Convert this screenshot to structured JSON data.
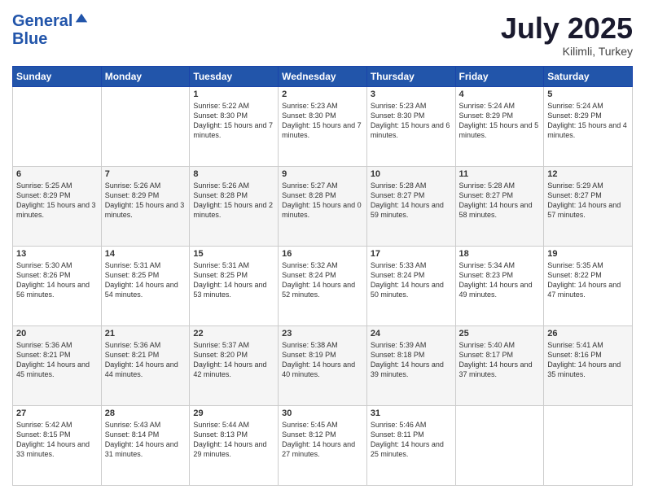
{
  "logo": {
    "line1": "General",
    "line2": "Blue"
  },
  "title": "July 2025",
  "location": "Kilimli, Turkey",
  "weekdays": [
    "Sunday",
    "Monday",
    "Tuesday",
    "Wednesday",
    "Thursday",
    "Friday",
    "Saturday"
  ],
  "weeks": [
    [
      {
        "day": "",
        "sunrise": "",
        "sunset": "",
        "daylight": ""
      },
      {
        "day": "",
        "sunrise": "",
        "sunset": "",
        "daylight": ""
      },
      {
        "day": "1",
        "sunrise": "Sunrise: 5:22 AM",
        "sunset": "Sunset: 8:30 PM",
        "daylight": "Daylight: 15 hours and 7 minutes."
      },
      {
        "day": "2",
        "sunrise": "Sunrise: 5:23 AM",
        "sunset": "Sunset: 8:30 PM",
        "daylight": "Daylight: 15 hours and 7 minutes."
      },
      {
        "day": "3",
        "sunrise": "Sunrise: 5:23 AM",
        "sunset": "Sunset: 8:30 PM",
        "daylight": "Daylight: 15 hours and 6 minutes."
      },
      {
        "day": "4",
        "sunrise": "Sunrise: 5:24 AM",
        "sunset": "Sunset: 8:29 PM",
        "daylight": "Daylight: 15 hours and 5 minutes."
      },
      {
        "day": "5",
        "sunrise": "Sunrise: 5:24 AM",
        "sunset": "Sunset: 8:29 PM",
        "daylight": "Daylight: 15 hours and 4 minutes."
      }
    ],
    [
      {
        "day": "6",
        "sunrise": "Sunrise: 5:25 AM",
        "sunset": "Sunset: 8:29 PM",
        "daylight": "Daylight: 15 hours and 3 minutes."
      },
      {
        "day": "7",
        "sunrise": "Sunrise: 5:26 AM",
        "sunset": "Sunset: 8:29 PM",
        "daylight": "Daylight: 15 hours and 3 minutes."
      },
      {
        "day": "8",
        "sunrise": "Sunrise: 5:26 AM",
        "sunset": "Sunset: 8:28 PM",
        "daylight": "Daylight: 15 hours and 2 minutes."
      },
      {
        "day": "9",
        "sunrise": "Sunrise: 5:27 AM",
        "sunset": "Sunset: 8:28 PM",
        "daylight": "Daylight: 15 hours and 0 minutes."
      },
      {
        "day": "10",
        "sunrise": "Sunrise: 5:28 AM",
        "sunset": "Sunset: 8:27 PM",
        "daylight": "Daylight: 14 hours and 59 minutes."
      },
      {
        "day": "11",
        "sunrise": "Sunrise: 5:28 AM",
        "sunset": "Sunset: 8:27 PM",
        "daylight": "Daylight: 14 hours and 58 minutes."
      },
      {
        "day": "12",
        "sunrise": "Sunrise: 5:29 AM",
        "sunset": "Sunset: 8:27 PM",
        "daylight": "Daylight: 14 hours and 57 minutes."
      }
    ],
    [
      {
        "day": "13",
        "sunrise": "Sunrise: 5:30 AM",
        "sunset": "Sunset: 8:26 PM",
        "daylight": "Daylight: 14 hours and 56 minutes."
      },
      {
        "day": "14",
        "sunrise": "Sunrise: 5:31 AM",
        "sunset": "Sunset: 8:25 PM",
        "daylight": "Daylight: 14 hours and 54 minutes."
      },
      {
        "day": "15",
        "sunrise": "Sunrise: 5:31 AM",
        "sunset": "Sunset: 8:25 PM",
        "daylight": "Daylight: 14 hours and 53 minutes."
      },
      {
        "day": "16",
        "sunrise": "Sunrise: 5:32 AM",
        "sunset": "Sunset: 8:24 PM",
        "daylight": "Daylight: 14 hours and 52 minutes."
      },
      {
        "day": "17",
        "sunrise": "Sunrise: 5:33 AM",
        "sunset": "Sunset: 8:24 PM",
        "daylight": "Daylight: 14 hours and 50 minutes."
      },
      {
        "day": "18",
        "sunrise": "Sunrise: 5:34 AM",
        "sunset": "Sunset: 8:23 PM",
        "daylight": "Daylight: 14 hours and 49 minutes."
      },
      {
        "day": "19",
        "sunrise": "Sunrise: 5:35 AM",
        "sunset": "Sunset: 8:22 PM",
        "daylight": "Daylight: 14 hours and 47 minutes."
      }
    ],
    [
      {
        "day": "20",
        "sunrise": "Sunrise: 5:36 AM",
        "sunset": "Sunset: 8:21 PM",
        "daylight": "Daylight: 14 hours and 45 minutes."
      },
      {
        "day": "21",
        "sunrise": "Sunrise: 5:36 AM",
        "sunset": "Sunset: 8:21 PM",
        "daylight": "Daylight: 14 hours and 44 minutes."
      },
      {
        "day": "22",
        "sunrise": "Sunrise: 5:37 AM",
        "sunset": "Sunset: 8:20 PM",
        "daylight": "Daylight: 14 hours and 42 minutes."
      },
      {
        "day": "23",
        "sunrise": "Sunrise: 5:38 AM",
        "sunset": "Sunset: 8:19 PM",
        "daylight": "Daylight: 14 hours and 40 minutes."
      },
      {
        "day": "24",
        "sunrise": "Sunrise: 5:39 AM",
        "sunset": "Sunset: 8:18 PM",
        "daylight": "Daylight: 14 hours and 39 minutes."
      },
      {
        "day": "25",
        "sunrise": "Sunrise: 5:40 AM",
        "sunset": "Sunset: 8:17 PM",
        "daylight": "Daylight: 14 hours and 37 minutes."
      },
      {
        "day": "26",
        "sunrise": "Sunrise: 5:41 AM",
        "sunset": "Sunset: 8:16 PM",
        "daylight": "Daylight: 14 hours and 35 minutes."
      }
    ],
    [
      {
        "day": "27",
        "sunrise": "Sunrise: 5:42 AM",
        "sunset": "Sunset: 8:15 PM",
        "daylight": "Daylight: 14 hours and 33 minutes."
      },
      {
        "day": "28",
        "sunrise": "Sunrise: 5:43 AM",
        "sunset": "Sunset: 8:14 PM",
        "daylight": "Daylight: 14 hours and 31 minutes."
      },
      {
        "day": "29",
        "sunrise": "Sunrise: 5:44 AM",
        "sunset": "Sunset: 8:13 PM",
        "daylight": "Daylight: 14 hours and 29 minutes."
      },
      {
        "day": "30",
        "sunrise": "Sunrise: 5:45 AM",
        "sunset": "Sunset: 8:12 PM",
        "daylight": "Daylight: 14 hours and 27 minutes."
      },
      {
        "day": "31",
        "sunrise": "Sunrise: 5:46 AM",
        "sunset": "Sunset: 8:11 PM",
        "daylight": "Daylight: 14 hours and 25 minutes."
      },
      {
        "day": "",
        "sunrise": "",
        "sunset": "",
        "daylight": ""
      },
      {
        "day": "",
        "sunrise": "",
        "sunset": "",
        "daylight": ""
      }
    ]
  ]
}
